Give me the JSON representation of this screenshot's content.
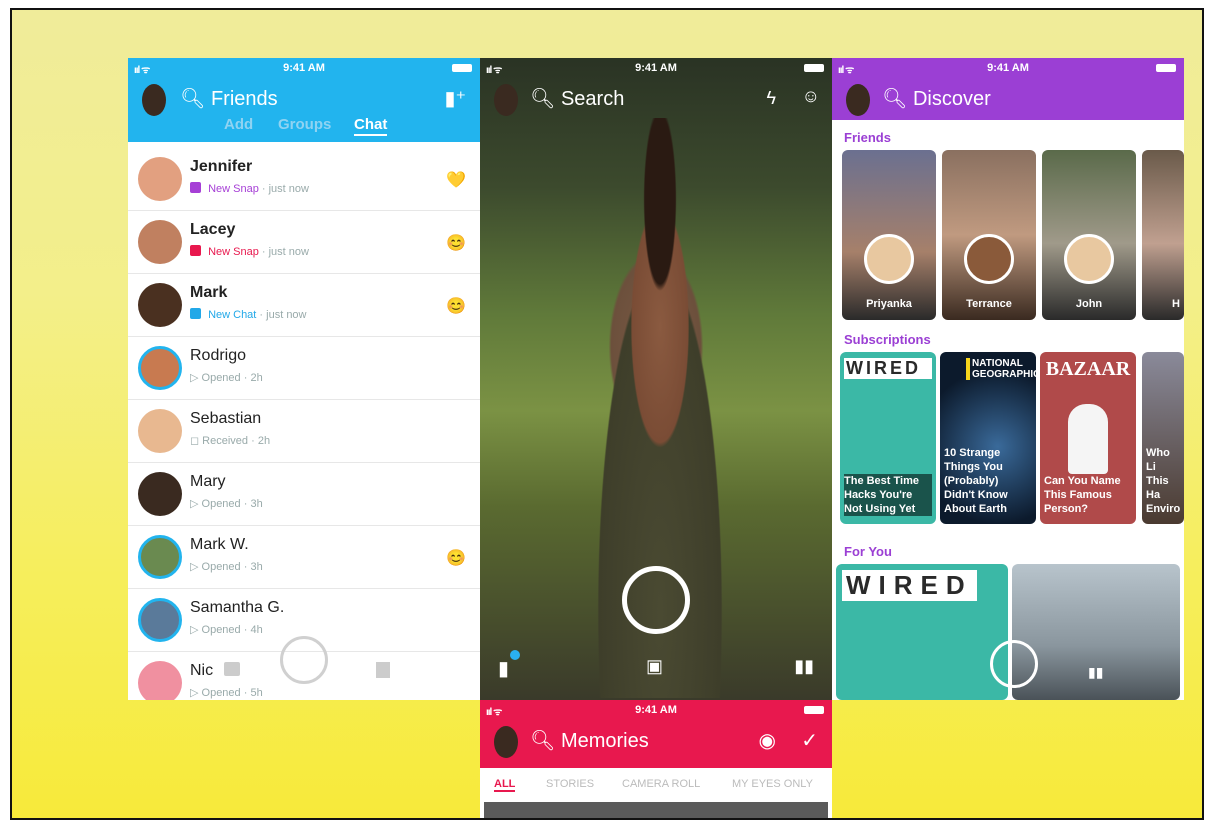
{
  "status": {
    "time": "9:41 AM"
  },
  "chat": {
    "title": "Friends",
    "tabs": [
      "Add",
      "Groups",
      "Chat"
    ],
    "rows": [
      {
        "name": "Jennifer",
        "tag": "New Snap",
        "time": "· just now",
        "tag_color": "#a63fd6",
        "emoji": "💛"
      },
      {
        "name": "Lacey",
        "tag": "New Snap",
        "time": "· just now",
        "tag_color": "#e8184e",
        "emoji": "😊"
      },
      {
        "name": "Mark",
        "tag": "New Chat",
        "time": "· just now",
        "tag_color": "#22a8e8",
        "emoji": "😊"
      },
      {
        "name": "Rodrigo",
        "tag": "▷ Opened",
        "time": "· 2h",
        "tag_color": "#9aa",
        "emoji": ""
      },
      {
        "name": "Sebastian",
        "tag": "◻ Received",
        "time": "· 2h",
        "tag_color": "#9aa",
        "emoji": ""
      },
      {
        "name": "Mary",
        "tag": "▷ Opened",
        "time": "· 3h",
        "tag_color": "#9aa",
        "emoji": ""
      },
      {
        "name": "Mark W.",
        "tag": "▷ Opened",
        "time": "· 3h",
        "tag_color": "#9aa",
        "emoji": "😊"
      },
      {
        "name": "Samantha G.",
        "tag": "▷ Opened",
        "time": "· 4h",
        "tag_color": "#9aa",
        "emoji": ""
      },
      {
        "name": "Nic",
        "tag": "▷ Opened",
        "time": "· 5h",
        "tag_color": "#9aa",
        "emoji": ""
      }
    ]
  },
  "camera": {
    "title": "Search"
  },
  "memories": {
    "title": "Memories",
    "tabs": [
      "ALL",
      "STORIES",
      "CAMERA ROLL",
      "MY EYES ONLY"
    ]
  },
  "discover": {
    "title": "Discover",
    "friends_label": "Friends",
    "friends": [
      "Priyanka",
      "Terrance",
      "John",
      "H"
    ],
    "subscriptions_label": "Subscriptions",
    "subscriptions": [
      {
        "brand": "WIRED",
        "title": "The Best Time Hacks You're Not Using Yet"
      },
      {
        "brand": "NATIONAL GEOGRAPHIC",
        "title": "10 Strange Things You (Probably) Didn't Know About Earth"
      },
      {
        "brand": "BAZAAR",
        "title": "Can You Name This Famous Person?"
      },
      {
        "brand": "",
        "title": "Who Li This Ha Enviro"
      }
    ],
    "for_you_label": "For You",
    "for_you_brand": "WIRED"
  },
  "colors": {
    "chat": "#22b4ee",
    "memories": "#e8184e",
    "discover": "#9b3fd4"
  }
}
